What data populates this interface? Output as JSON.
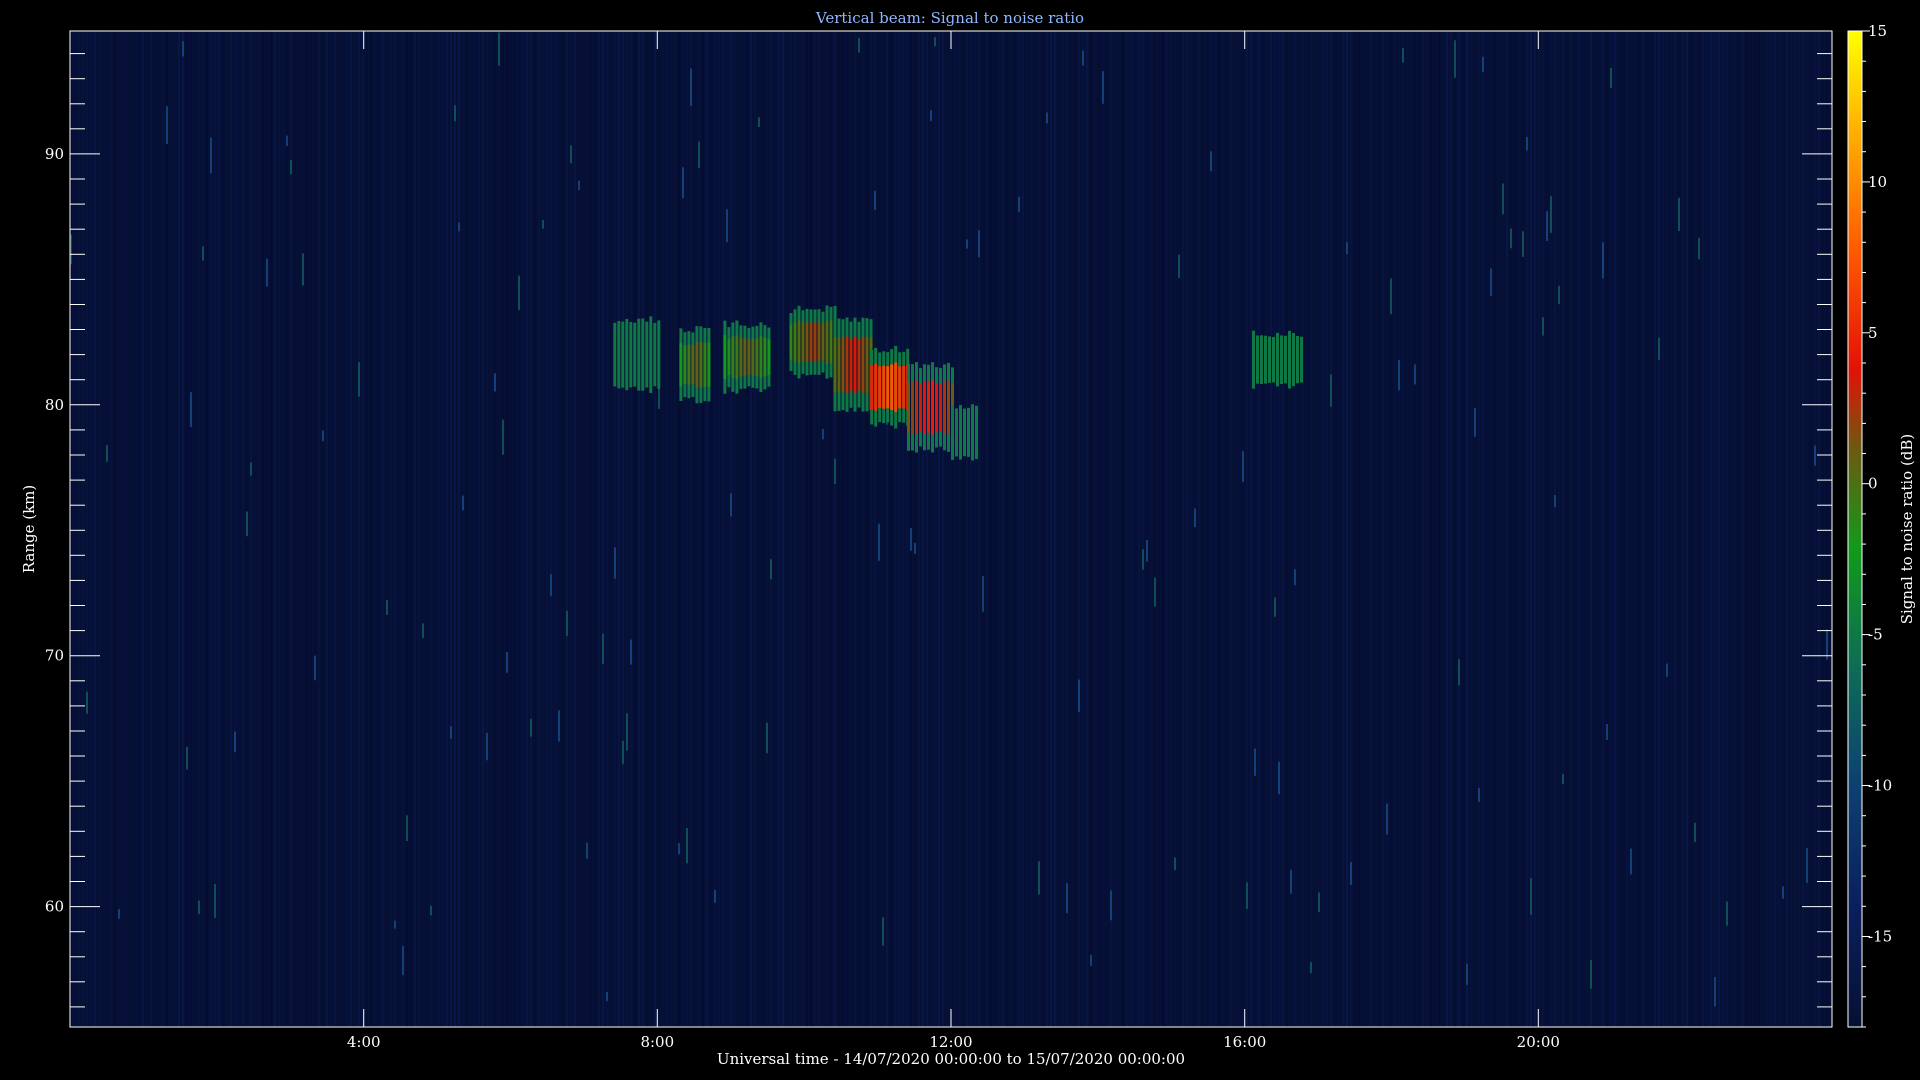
{
  "chart_data": {
    "type": "heatmap",
    "title": "Vertical beam: Signal to noise ratio",
    "xlabel": "Universal time - 14/07/2020 00:00:00 to 15/07/2020 00:00:00",
    "ylabel": "Range (km)",
    "colorbar_label": "Signal to noise ratio (dB)",
    "xlim": [
      0,
      24
    ],
    "ylim": [
      55.2,
      94.9
    ],
    "x_tick_labels": [
      "4:00",
      "8:00",
      "12:00",
      "16:00",
      "20:00"
    ],
    "x_tick_values": [
      4,
      8,
      12,
      16,
      20
    ],
    "y_tick_labels": [
      "60",
      "70",
      "80",
      "90"
    ],
    "y_tick_values": [
      60,
      70,
      80,
      90
    ],
    "colorbar_ticks": [
      "15",
      "10",
      "5",
      "0",
      "-5",
      "-10",
      "-15"
    ],
    "colorbar_tick_values": [
      15,
      10,
      5,
      0,
      -5,
      -10,
      -15
    ],
    "colorbar_range": [
      -18,
      15
    ],
    "background_snr_db": -17,
    "features": [
      {
        "t_start": 7.4,
        "t_end": 8.0,
        "r_low": 80.6,
        "r_high": 83.4,
        "peak_snr_db": -5
      },
      {
        "t_start": 8.3,
        "t_end": 8.7,
        "r_low": 80.2,
        "r_high": 83.0,
        "peak_snr_db": 0
      },
      {
        "t_start": 8.9,
        "t_end": 9.5,
        "r_low": 80.6,
        "r_high": 83.2,
        "peak_snr_db": 0
      },
      {
        "t_start": 9.8,
        "t_end": 10.4,
        "r_low": 81.2,
        "r_high": 83.8,
        "peak_snr_db": 1
      },
      {
        "t_start": 10.4,
        "t_end": 10.9,
        "r_low": 79.8,
        "r_high": 83.4,
        "peak_snr_db": 2
      },
      {
        "t_start": 10.9,
        "t_end": 11.4,
        "r_low": 79.2,
        "r_high": 82.2,
        "peak_snr_db": 6
      },
      {
        "t_start": 11.4,
        "t_end": 12.0,
        "r_low": 78.2,
        "r_high": 81.6,
        "peak_snr_db": 3
      },
      {
        "t_start": 12.0,
        "t_end": 12.35,
        "r_low": 77.8,
        "r_high": 80.0,
        "peak_snr_db": -6
      },
      {
        "t_start": 16.1,
        "t_end": 16.8,
        "r_low": 80.8,
        "r_high": 82.8,
        "peak_snr_db": -6
      }
    ]
  }
}
